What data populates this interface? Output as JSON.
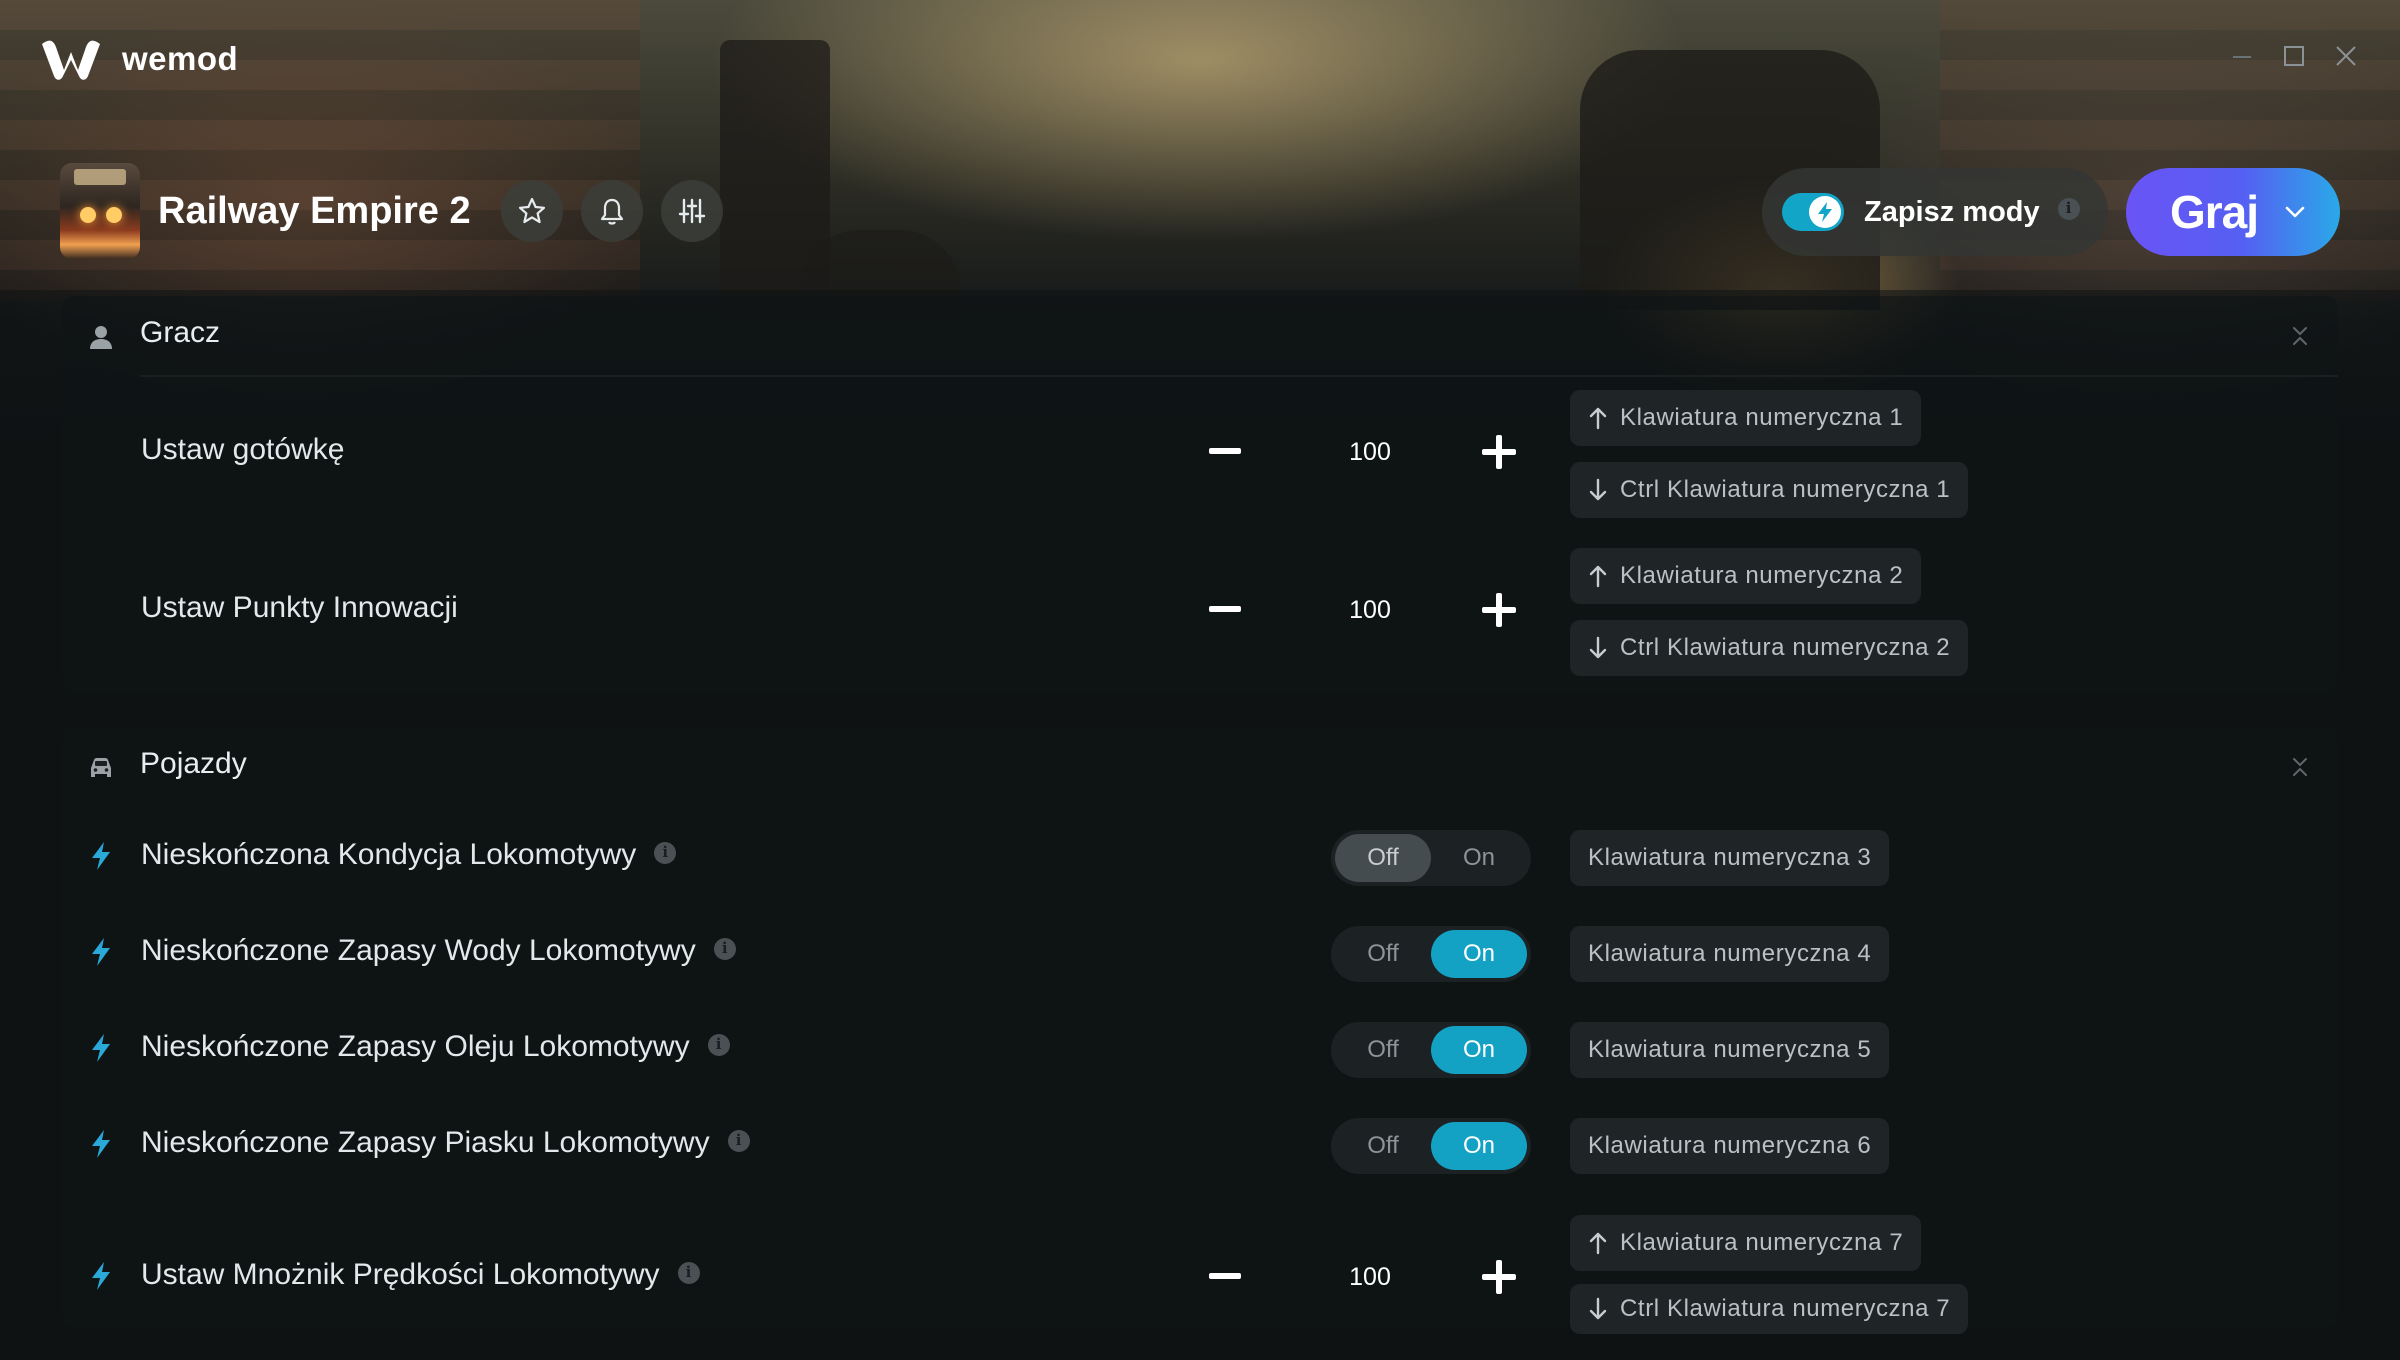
{
  "app": {
    "name": "wemod"
  },
  "game": {
    "title": "Railway Empire 2"
  },
  "save_mods": {
    "label": "Zapisz mody",
    "enabled": true,
    "toggle_color": "#12a5c8"
  },
  "play": {
    "label": "Graj"
  },
  "colors": {
    "accent_on": "#13a1c4",
    "play_gradient_start": "#6a54f6",
    "play_gradient_end": "#2aa9e8",
    "bolt": "#2aa8d8"
  },
  "sections": [
    {
      "label": "Gracz",
      "icon": "user-icon",
      "rows": [
        {
          "type": "stepper",
          "label": "Ustaw gotówkę",
          "value": "100",
          "info": false,
          "hotkeys": {
            "up": "Klawiatura numeryczna 1",
            "down": "Ctrl Klawiatura numeryczna 1"
          }
        },
        {
          "type": "stepper",
          "label": "Ustaw Punkty Innowacji",
          "value": "100",
          "info": false,
          "hotkeys": {
            "up": "Klawiatura numeryczna 2",
            "down": "Ctrl Klawiatura numeryczna 2"
          }
        }
      ]
    },
    {
      "label": "Pojazdy",
      "icon": "car-icon",
      "rows": [
        {
          "type": "toggle",
          "label": "Nieskończona Kondycja Lokomotywy",
          "off_label": "Off",
          "on_label": "On",
          "state": "off",
          "info": true,
          "hotkey": "Klawiatura numeryczna 3"
        },
        {
          "type": "toggle",
          "label": "Nieskończone Zapasy Wody Lokomotywy",
          "off_label": "Off",
          "on_label": "On",
          "state": "on",
          "info": true,
          "hotkey": "Klawiatura numeryczna 4"
        },
        {
          "type": "toggle",
          "label": "Nieskończone Zapasy Oleju Lokomotywy",
          "off_label": "Off",
          "on_label": "On",
          "state": "on",
          "info": true,
          "hotkey": "Klawiatura numeryczna 5"
        },
        {
          "type": "toggle",
          "label": "Nieskończone Zapasy Piasku Lokomotywy",
          "off_label": "Off",
          "on_label": "On",
          "state": "on",
          "info": true,
          "hotkey": "Klawiatura numeryczna 6"
        },
        {
          "type": "stepper",
          "label": "Ustaw Mnożnik Prędkości Lokomotywy",
          "value": "100",
          "info": true,
          "hotkeys": {
            "up": "Klawiatura numeryczna 7",
            "down": "Ctrl Klawiatura numeryczna 7"
          }
        }
      ]
    }
  ]
}
